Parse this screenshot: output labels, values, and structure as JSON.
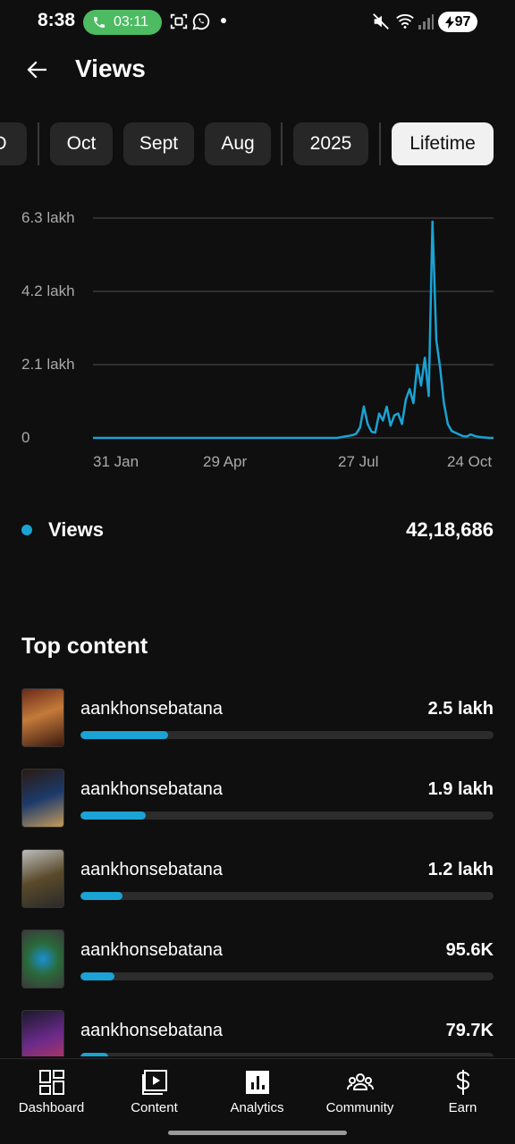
{
  "status_bar": {
    "time": "8:38",
    "call_timer": "03:11",
    "battery": "97",
    "icons": [
      "phone-icon",
      "screen-record-icon",
      "whatsapp-icon",
      "mute-icon",
      "wifi-icon",
      "signal-icon",
      "battery-charging-icon"
    ]
  },
  "header": {
    "title": "Views",
    "back_icon": "arrow-left-icon"
  },
  "chips": [
    {
      "label": "D",
      "active": false
    },
    {
      "label": "Oct",
      "active": false
    },
    {
      "label": "Sept",
      "active": false
    },
    {
      "label": "Aug",
      "active": false
    },
    {
      "label": "2025",
      "active": false
    },
    {
      "label": "Lifetime",
      "active": true
    }
  ],
  "chart_data": {
    "type": "line",
    "y_ticks": [
      "6.3 lakh",
      "4.2 lakh",
      "2.1 lakh",
      "0"
    ],
    "x_ticks": [
      "31 Jan",
      "29 Apr",
      "27 Jul",
      "24 Oct"
    ],
    "ylim": [
      0,
      630000
    ],
    "grid": true,
    "color": "#1aa3d4",
    "series": [
      {
        "name": "Views",
        "values": [
          0,
          0,
          0,
          0,
          0,
          0,
          0,
          0,
          0,
          0,
          0,
          0,
          0,
          0,
          0,
          0,
          0,
          0,
          0,
          0,
          0,
          0,
          0,
          0,
          0,
          0,
          0,
          0,
          0,
          0,
          0,
          0,
          0,
          0,
          0,
          0,
          0,
          0,
          0,
          0,
          0,
          0,
          0,
          0,
          0,
          0,
          0,
          0,
          0,
          0,
          0,
          0,
          0,
          0,
          0,
          0,
          0,
          0,
          0,
          0,
          0,
          0,
          0,
          0,
          0,
          2000,
          4000,
          6000,
          8000,
          12000,
          30000,
          90000,
          40000,
          18000,
          15000,
          70000,
          50000,
          90000,
          35000,
          65000,
          70000,
          40000,
          110000,
          140000,
          100000,
          210000,
          150000,
          230000,
          120000,
          620000,
          280000,
          200000,
          100000,
          40000,
          20000,
          15000,
          10000,
          5000,
          4000,
          10000,
          6000,
          3000,
          2000,
          1000,
          0,
          0
        ]
      }
    ]
  },
  "legend": {
    "label": "Views",
    "value": "42,18,686"
  },
  "top_content": {
    "title": "Top content",
    "items": [
      {
        "title": "aankhonsebatana",
        "value": "2.5 lakh",
        "share": 0.213
      },
      {
        "title": "aankhonsebatana",
        "value": "1.9 lakh",
        "share": 0.158
      },
      {
        "title": "aankhonsebatana",
        "value": "1.2 lakh",
        "share": 0.102
      },
      {
        "title": "aankhonsebatana",
        "value": "95.6K",
        "share": 0.082
      },
      {
        "title": "aankhonsebatana",
        "value": "79.7K",
        "share": 0.068
      }
    ]
  },
  "bottom_nav": [
    {
      "label": "Dashboard",
      "icon": "dashboard-icon"
    },
    {
      "label": "Content",
      "icon": "content-icon"
    },
    {
      "label": "Analytics",
      "icon": "analytics-icon"
    },
    {
      "label": "Community",
      "icon": "community-icon"
    },
    {
      "label": "Earn",
      "icon": "dollar-icon"
    }
  ]
}
